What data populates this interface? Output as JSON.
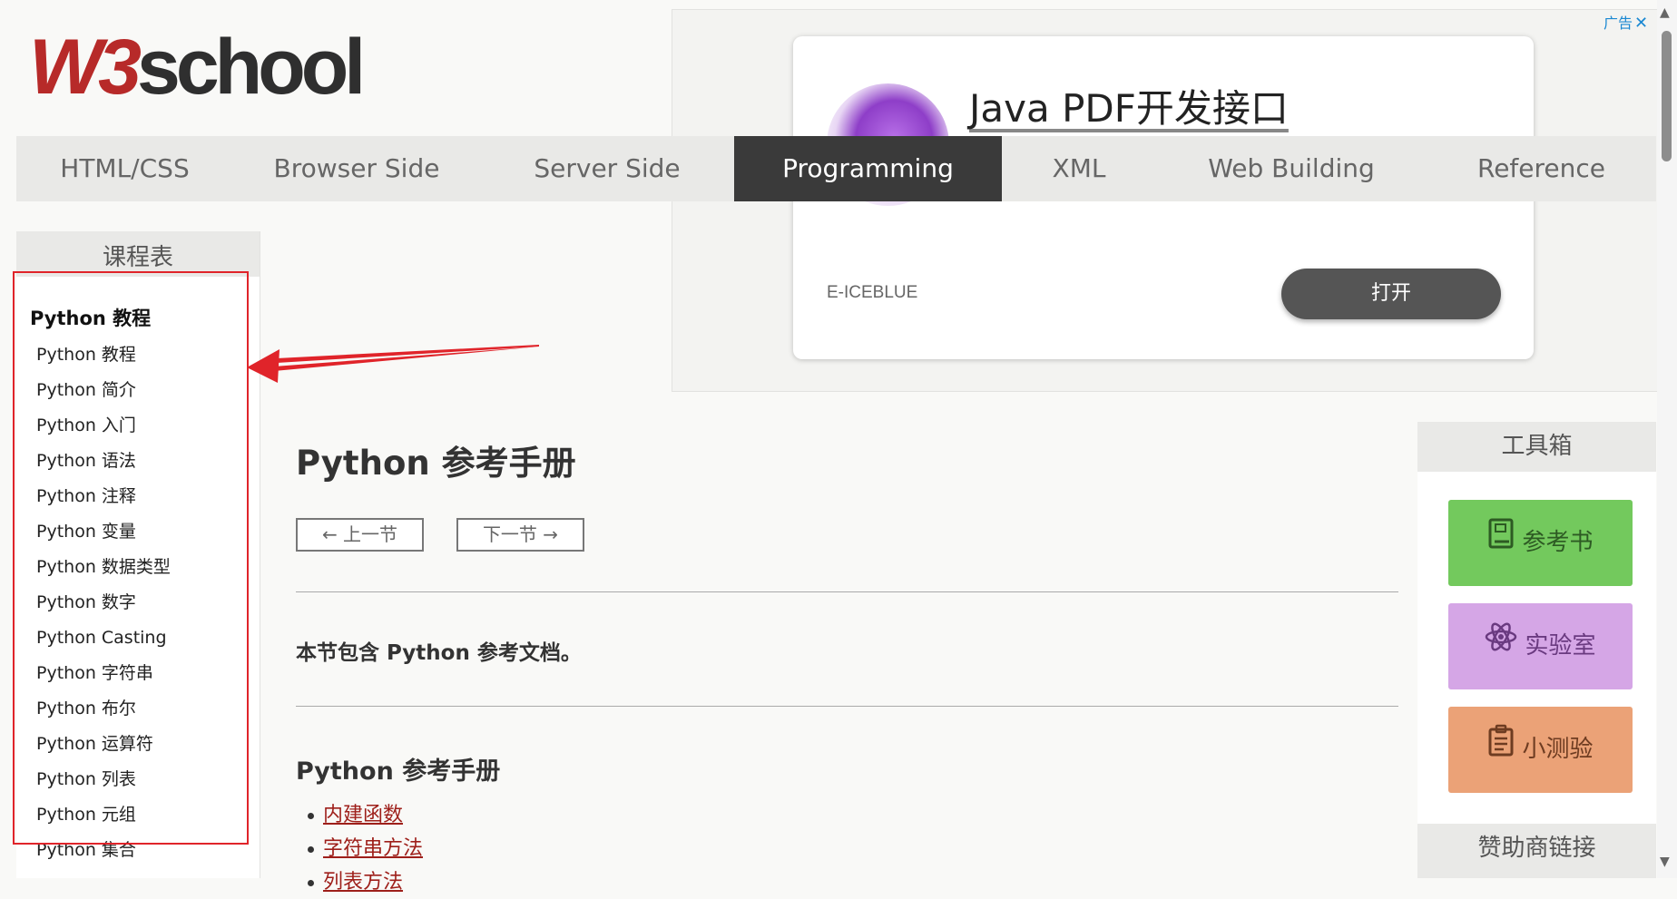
{
  "logo": {
    "w3": "W3",
    "school": "school"
  },
  "nav": {
    "items": [
      {
        "label": "HTML/CSS",
        "active": false
      },
      {
        "label": "Browser Side",
        "active": false
      },
      {
        "label": "Server Side",
        "active": false
      },
      {
        "label": "Programming",
        "active": true
      },
      {
        "label": "XML",
        "active": false
      },
      {
        "label": "Web Building",
        "active": false
      },
      {
        "label": "Reference",
        "active": false
      }
    ]
  },
  "ad": {
    "badge": "广告",
    "close": "✕",
    "title": "Java PDF开发接口",
    "brand": "E-ICEBLUE",
    "button": "打开"
  },
  "sidebar": {
    "header": "课程表",
    "section": "Python 教程",
    "items": [
      "Python 教程",
      "Python 简介",
      "Python 入门",
      "Python 语法",
      "Python 注释",
      "Python 变量",
      "Python 数据类型",
      "Python 数字",
      "Python Casting",
      "Python 字符串",
      "Python 布尔",
      "Python 运算符",
      "Python 列表",
      "Python 元组",
      "Python 集合"
    ]
  },
  "main": {
    "title": "Python 参考手册",
    "prev": "← 上一节",
    "next": "下一节 →",
    "intro": "本节包含 Python 参考文档。",
    "section_title": "Python 参考手册",
    "links": [
      "内建函数",
      "字符串方法",
      "列表方法"
    ]
  },
  "toolbox": {
    "header": "工具箱",
    "reference": "参考书",
    "lab": "实验室",
    "quiz": "小测验"
  },
  "sponsor": {
    "header": "赞助商链接"
  },
  "colors": {
    "brand_red": "#b72a29",
    "nav_active": "#3a3a3a",
    "link": "#9e1f1a",
    "highlight": "#e0242a",
    "reference_green": "#73c95d",
    "lab_purple": "#d5a6e6",
    "quiz_orange": "#eba277"
  }
}
